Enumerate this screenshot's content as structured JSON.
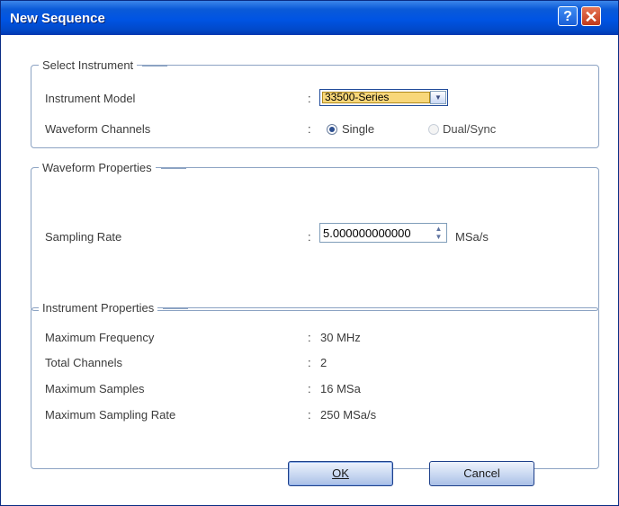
{
  "window": {
    "title": "New Sequence",
    "help_label": "?",
    "close_label": "✕"
  },
  "select_instrument": {
    "legend": "Select Instrument",
    "model_label": "Instrument Model",
    "model_value": "33500-Series",
    "channels_label": "Waveform Channels",
    "channel_options": [
      "Single",
      "Dual/Sync"
    ],
    "selected_channel": "Single"
  },
  "waveform_properties": {
    "legend": "Waveform Properties",
    "sampling_rate_label": "Sampling Rate",
    "sampling_rate_value": "5.000000000000",
    "sampling_rate_unit": "MSa/s"
  },
  "instrument_properties": {
    "legend": "Instrument Properties",
    "rows": [
      {
        "label": "Maximum Frequency",
        "value": "30 MHz"
      },
      {
        "label": "Total Channels",
        "value": "2"
      },
      {
        "label": "Maximum Samples",
        "value": "16 MSa"
      },
      {
        "label": "Maximum Sampling Rate",
        "value": "250 MSa/s"
      }
    ]
  },
  "buttons": {
    "ok": "OK",
    "cancel": "Cancel"
  },
  "colon": ":"
}
